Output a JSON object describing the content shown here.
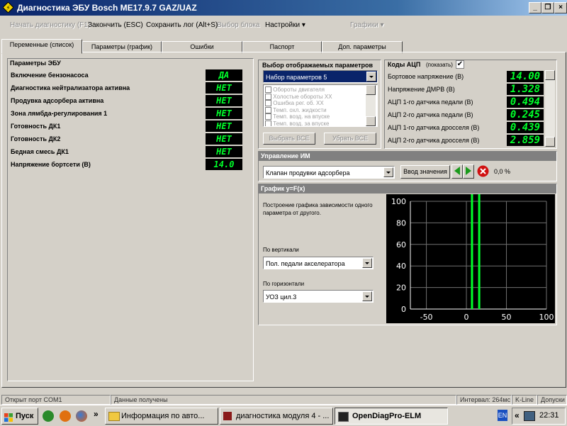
{
  "window": {
    "title": "Диагностика ЭБУ Bosch ME17.9.7 GAZ/UAZ"
  },
  "menu": {
    "start": "Начать диагностику (F1)",
    "finish": "Закончить (ESC)",
    "save_log": "Сохранить лог (Alt+S)",
    "choose_block": "Выбор блока",
    "settings": "Настройки",
    "graphs": "Графики"
  },
  "tabs": [
    "Переменные (список)",
    "Параметры (график)",
    "Ошибки",
    "Паспорт",
    "Доп. параметры"
  ],
  "ecu_params": {
    "title": "Параметры ЭБУ",
    "rows": [
      {
        "label": "Включение бензонасоса",
        "value": "ДА"
      },
      {
        "label": "Диагностика нейтрализатора активна",
        "value": "НЕТ"
      },
      {
        "label": "Продувка адсорбера активна",
        "value": "НЕТ"
      },
      {
        "label": "Зона лямбда-регулирования 1",
        "value": "НЕТ"
      },
      {
        "label": "Готовность ДК1",
        "value": "НЕТ"
      },
      {
        "label": "Готовность ДК2",
        "value": "НЕТ"
      },
      {
        "label": "Бедная смесь ДК1",
        "value": "НЕТ"
      },
      {
        "label": "Напряжение бортсети (В)",
        "value": "14.0"
      }
    ]
  },
  "param_select": {
    "title": "Выбор отображаемых параметров",
    "selected_set": "Набор параметров 5",
    "list": [
      "Обороты двигателя",
      "Холостые обороты XX",
      "Ошибка рег. об. XX",
      "Темп. охл. жидкости",
      "Темп. возд. на впуске",
      "Темп. возд. за впуске"
    ],
    "select_all": "Выбрать ВСЕ",
    "remove_all": "Убрать ВСЕ"
  },
  "adc": {
    "title": "Коды АЦП",
    "show_label": "(показать)",
    "show_checked": true,
    "rows": [
      {
        "label": "Бортовое напряжение (В)",
        "value": "14.00"
      },
      {
        "label": "Напряжение ДМРВ (В)",
        "value": "1.328"
      },
      {
        "label": "АЦП 1-го датчика педали (В)",
        "value": "0.494"
      },
      {
        "label": "АЦП 2-го датчика педали (В)",
        "value": "0.245"
      },
      {
        "label": "АЦП 1-го датчика дросселя (В)",
        "value": "0.439"
      },
      {
        "label": "АЦП 2-го датчика дросселя (В)",
        "value": "2.859"
      }
    ]
  },
  "im_control": {
    "title": "Управление ИМ",
    "actuator": "Клапан продувки адсорбера",
    "input_button": "Ввод значения",
    "value": "0,0 %"
  },
  "graph_panel": {
    "title": "График y=F(x)",
    "description": "Построение графика зависимости одного параметра от другого.",
    "vertical_label": "По вертикали",
    "vertical_value": "Пол. педали акселератора",
    "horizontal_label": "По горизонтали",
    "horizontal_value": "УОЗ цил.3"
  },
  "chart_data": {
    "type": "scatter",
    "xlim": [
      -70,
      100
    ],
    "ylim": [
      0,
      100
    ],
    "xticks": [
      -50,
      0,
      50,
      100
    ],
    "yticks": [
      0,
      20,
      40,
      60,
      80,
      100
    ],
    "lines_x": [
      7,
      16
    ],
    "grid": true,
    "colors": {
      "background": "#000000",
      "grid": "#707070",
      "data": "#00ff2a",
      "text": "#ffffff"
    }
  },
  "status": {
    "port": "Открыт порт COM1",
    "data": "Данные получены",
    "interval": "Интервал: 264мс",
    "protocol": "K-Line",
    "allowed": "Допуски"
  },
  "taskbar": {
    "start": "Пуск",
    "more": "»",
    "windows": [
      "Информация   по авто...",
      "диагностика модуля 4 - ...",
      "OpenDiagPro-ELM"
    ],
    "lang": "EN",
    "time": "22:31"
  }
}
